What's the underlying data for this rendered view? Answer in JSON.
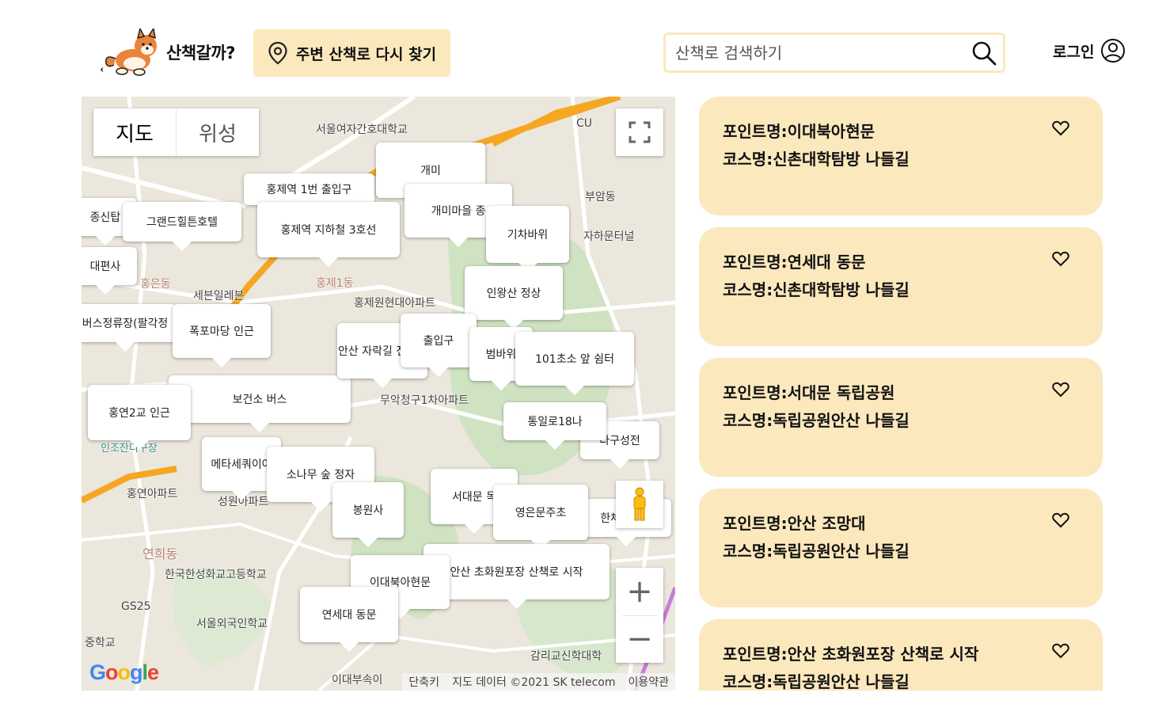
{
  "header": {
    "brand": "산책갈까?",
    "nearby_button": "주변 산책로 다시 찾기",
    "search_placeholder": "산책로 검색하기",
    "login": "로그인"
  },
  "map": {
    "type_tabs": [
      "지도",
      "위성"
    ],
    "places": [
      "서울여자간호대학교",
      "CU",
      "부암동",
      "자하문터널",
      "홍은동",
      "세븐일레븐",
      "홍제1동",
      "홍제원현대아파트",
      "무악청구1차아파트",
      "인조잔디구장",
      "홍연아파트",
      "성원아파트",
      "연희동",
      "한국한성화교고등학교",
      "GS25",
      "서울외국인학교",
      "중학교",
      "감리교신학대학",
      "이대부속이"
    ],
    "markers": [
      "그랜드힐튼호텔",
      "홍제역 지하철 3호선",
      "개미마을 종",
      "기차바위",
      "인왕산 정상",
      "폭포마당 인근",
      "안산 자락길 전망대",
      "출입구",
      "범바위",
      "101초소 앞 쉼터",
      "홍연2교 인근",
      "메타세쿼이아",
      "소나무 숲 정자",
      "봉원사",
      "서대문 독",
      "영은문주초",
      "안산 초화원포장 산책로 시작",
      "이대북아현문",
      "연세대 동문",
      "통일로18나",
      "종신탑",
      "대편사",
      "버스정류장(팔각정",
      "보건소 버스",
      "홍제역 1번 출입구",
      "개미",
      "한체육센터",
      "다구성전"
    ],
    "google_logo": "Google",
    "attribution": [
      "단축키",
      "지도 데이터 ©2021 SK telecom",
      "이용약관"
    ]
  },
  "courses": [
    {
      "point": "포인트명:이대북아현문",
      "course": "코스명:신촌대학탐방 나들길"
    },
    {
      "point": "포인트명:연세대 동문",
      "course": "코스명:신촌대학탐방 나들길"
    },
    {
      "point": "포인트명:서대문 독립공원",
      "course": "코스명:독립공원안산 나들길"
    },
    {
      "point": "포인트명:안산 조망대",
      "course": "코스명:독립공원안산 나들길"
    },
    {
      "point": "포인트명:안산 초화원포장 산책로 시작",
      "course": "코스명:독립공원안산 나들길"
    }
  ],
  "colors": {
    "accent": "#fbe8bd",
    "road_main": "#f5a623",
    "map_bg": "#e8e4d8"
  },
  "icons": [
    "dog-logo-icon",
    "location-pin-icon",
    "search-icon",
    "user-icon",
    "fullscreen-icon",
    "pegman-icon",
    "heart-icon"
  ]
}
